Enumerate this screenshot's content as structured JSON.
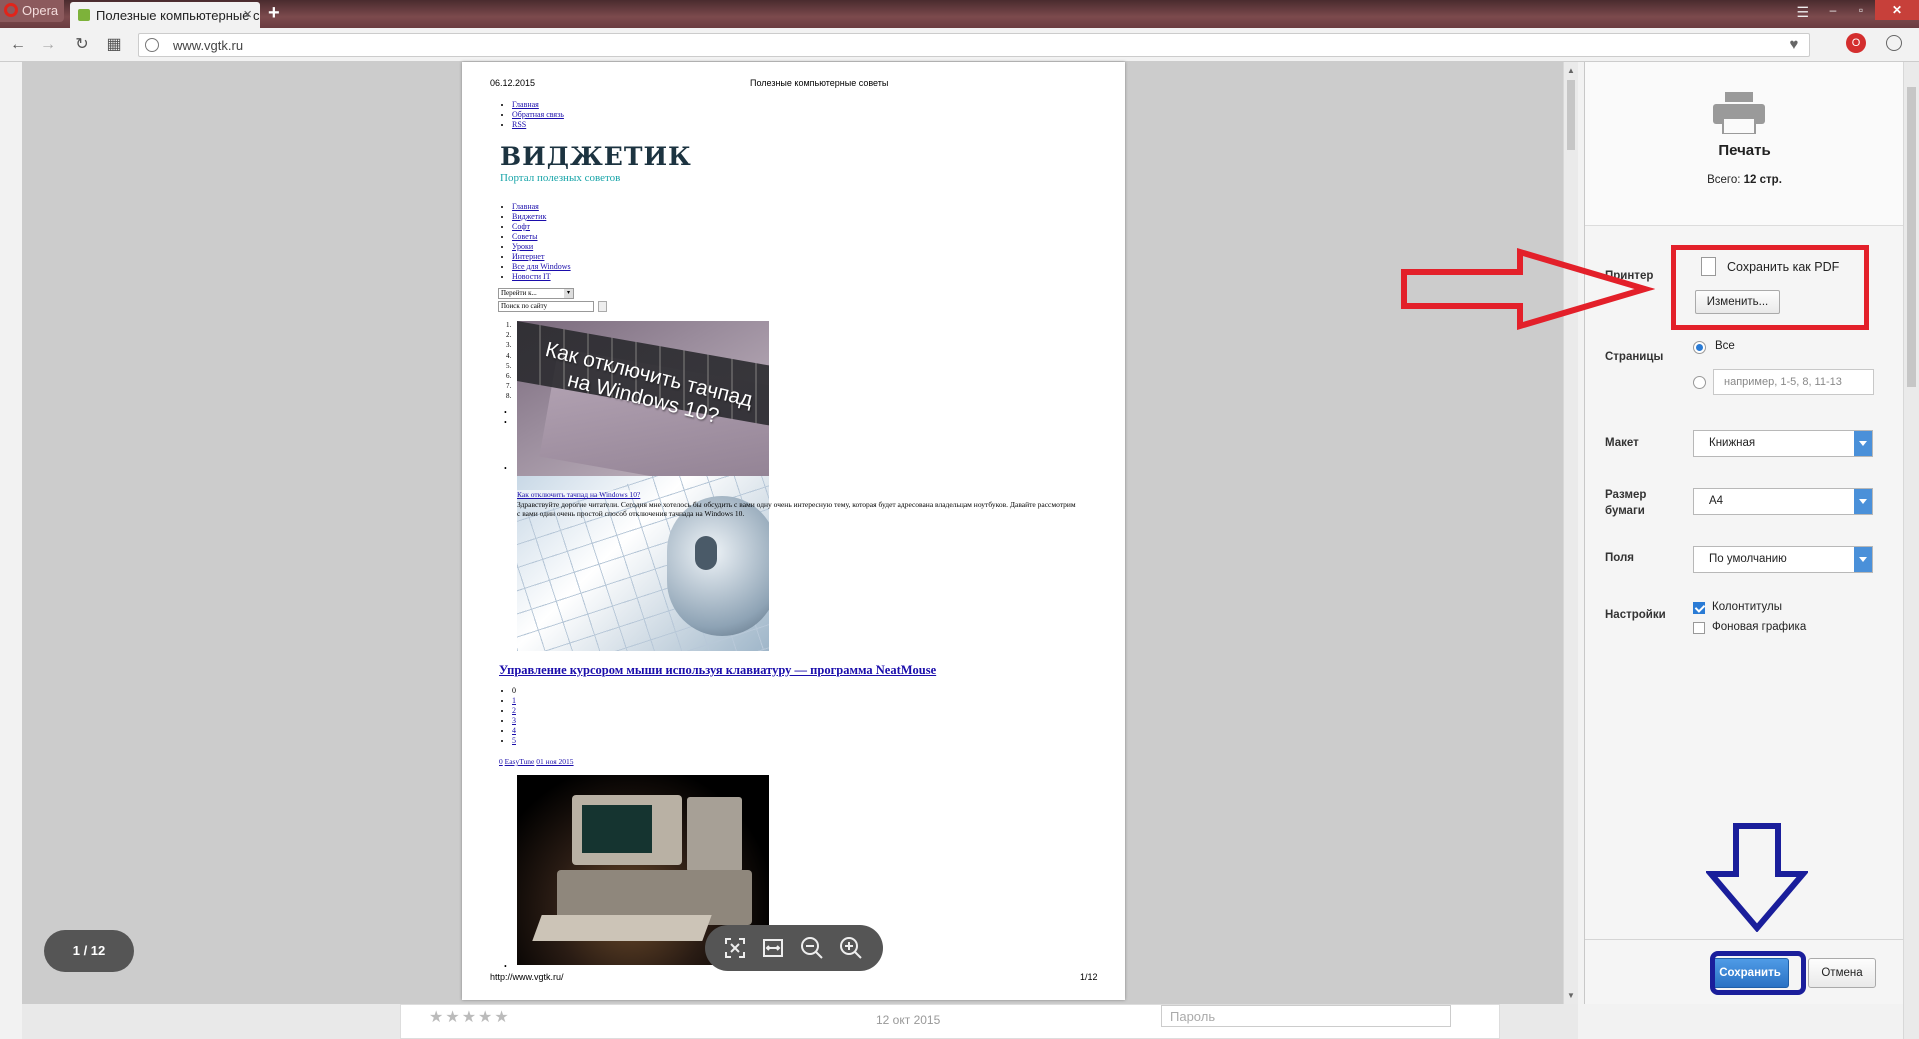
{
  "browser": {
    "menu_label": "Opera",
    "tab_title": "Полезные компьютерные советы",
    "tab_close": "×",
    "new_tab": "+",
    "url": "www.vgtk.ru",
    "window_min": "–",
    "window_max": "▫",
    "window_close": "✕"
  },
  "document": {
    "header_date": "06.12.2015",
    "header_title": "Полезные компьютерные советы",
    "footer_url": "http://www.vgtk.ru/",
    "footer_page": "1/12",
    "top_links": [
      "Главная",
      "Обратная связь",
      "RSS"
    ],
    "logo_title": "ВИДЖЕТИК",
    "logo_subtitle": "Портал полезных советов",
    "menu_links": [
      "Главная",
      "Виджетик",
      "Софт",
      "Советы",
      "Уроки",
      "Интернет",
      "Все для Windows",
      "Новости IT"
    ],
    "goto_select": "Перейти к...",
    "site_search": "Поиск по сайту",
    "numbered": [
      "1.",
      "2.",
      "3.",
      "4.",
      "5.",
      "6.",
      "7.",
      "8."
    ],
    "image1_caption": "Как отключить тачпад на Windows 10?",
    "article_link": "Как отключить тачпад на Windows 10?",
    "article_text": "Здравствуйте дорогие читатели. Сегодня мне хотелось бы обсудить с вами одну очень интересную тему, которая будет адресована владельцам ноутбуков. Давайте рассмотрим с вами один очень простой способ отключения тачпада на Windows 10.",
    "h2_link": "Управление курсором мыши используя клавиатуру — программа NeatMouse",
    "rating_items": [
      "0",
      "1",
      "2",
      "3",
      "4",
      "5"
    ],
    "meta_comments": "0",
    "meta_author": "EasyTune",
    "meta_date": "01 ноя 2015"
  },
  "preview": {
    "page_counter": "1 / 12",
    "behind_date": "12 окт 2015",
    "behind_password": "Пароль"
  },
  "print_panel": {
    "title": "Печать",
    "total_prefix": "Всего: ",
    "total_value": "12 стр.",
    "printer_label": "Принтер",
    "printer_value": "Сохранить как PDF",
    "change_button": "Изменить...",
    "pages_label": "Страницы",
    "pages_all": "Все",
    "pages_range_placeholder": "например, 1-5, 8, 11-13",
    "layout_label": "Макет",
    "layout_value": "Книжная",
    "paper_label": "Размер бумаги",
    "paper_value": "A4",
    "margins_label": "Поля",
    "margins_value": "По умолчанию",
    "settings_label": "Настройки",
    "headers_footers": "Колонтитулы",
    "headers_footers_checked": true,
    "background_graphics": "Фоновая графика",
    "background_graphics_checked": false,
    "save_button": "Сохранить",
    "cancel_button": "Отмена"
  },
  "colors": {
    "annotation_red": "#e3202a",
    "annotation_blue": "#1a1e9b",
    "accent_blue": "#2a7bd5"
  }
}
